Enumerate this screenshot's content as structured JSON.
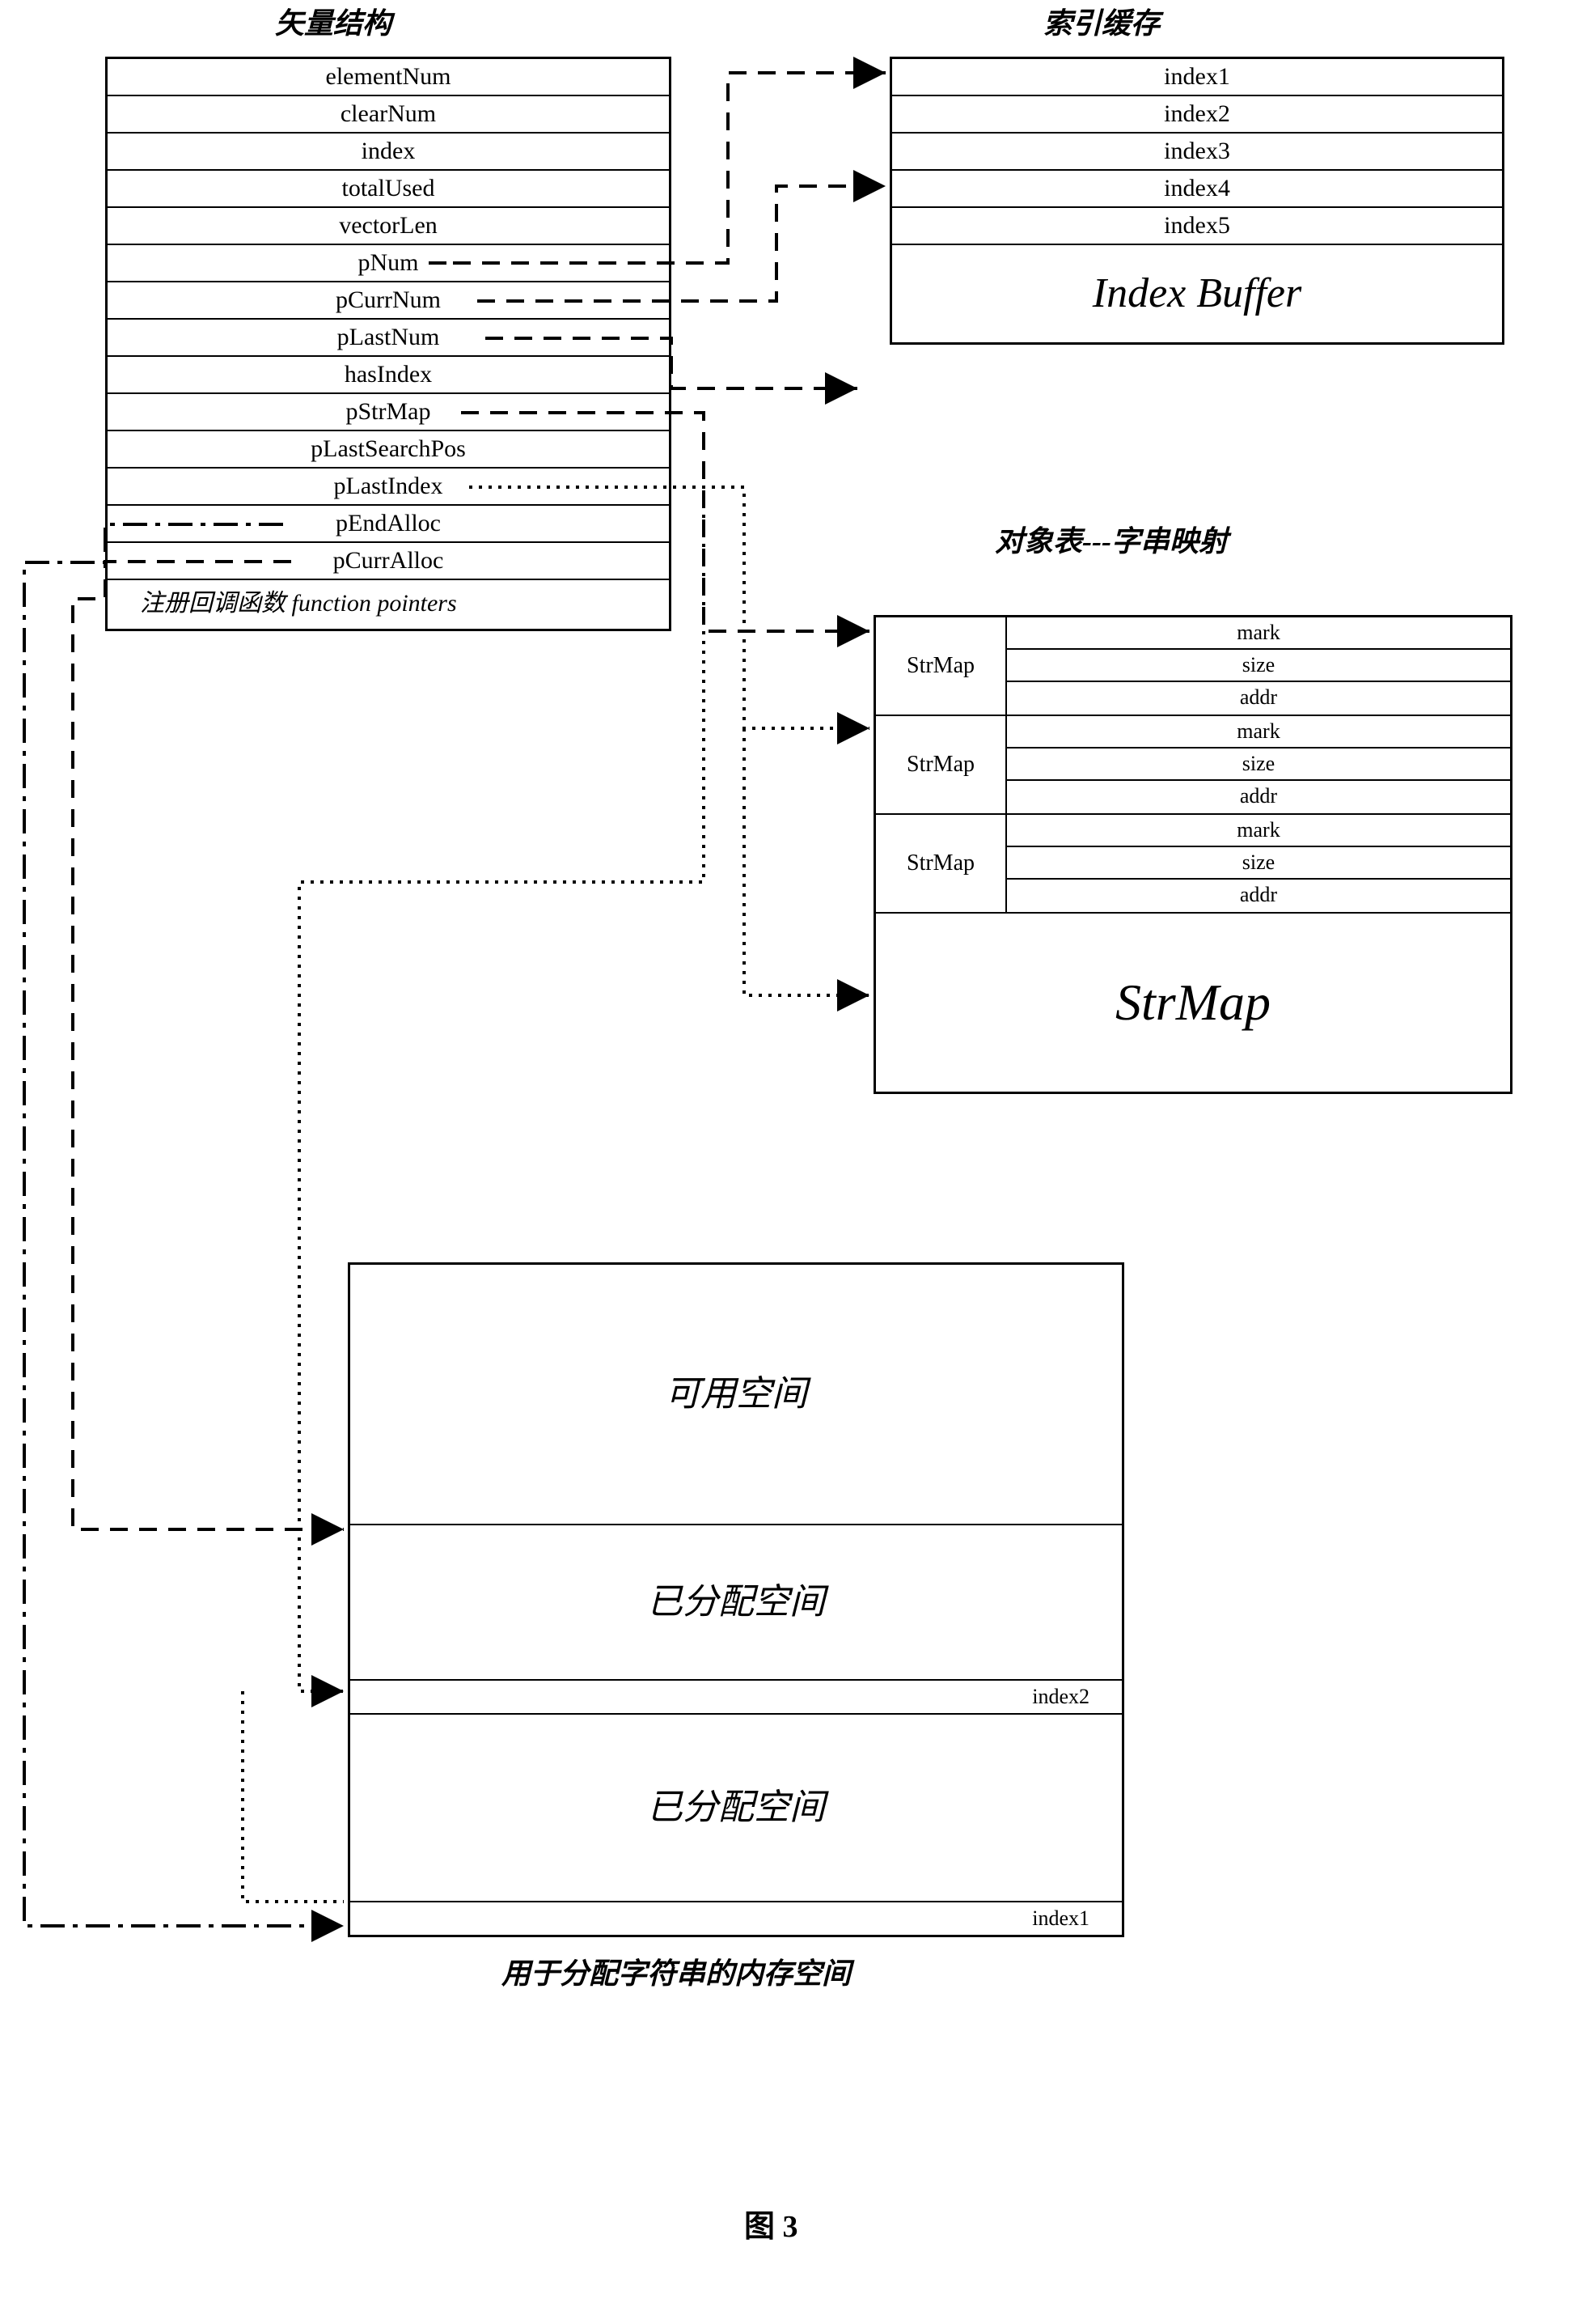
{
  "headings": {
    "vector_struct": "矢量结构",
    "index_cache": "索引缓存",
    "object_table": "对象表---字串映射",
    "mem_space": "用于分配字符串的内存空间"
  },
  "vector_fields": [
    "elementNum",
    "clearNum",
    "index",
    "totalUsed",
    "vectorLen",
    "pNum",
    "pCurrNum",
    "pLastNum",
    "hasIndex",
    "pStrMap",
    "pLastSearchPos",
    "pLastIndex",
    "pEndAlloc",
    "pCurrAlloc"
  ],
  "vector_footer": "注册回调函数    function pointers",
  "index_buffer": {
    "items": [
      "index1",
      "index2",
      "index3",
      "index4",
      "index5"
    ],
    "label": "Index Buffer"
  },
  "strmap": {
    "group_label": "StrMap",
    "fields": [
      "mark",
      "size",
      "addr"
    ],
    "big_label": "StrMap"
  },
  "memory": {
    "free": "可用空间",
    "alloc1": "已分配空间",
    "idx2": "index2",
    "alloc2": "已分配空间",
    "idx1": "index1"
  },
  "figure_caption": "图 3"
}
